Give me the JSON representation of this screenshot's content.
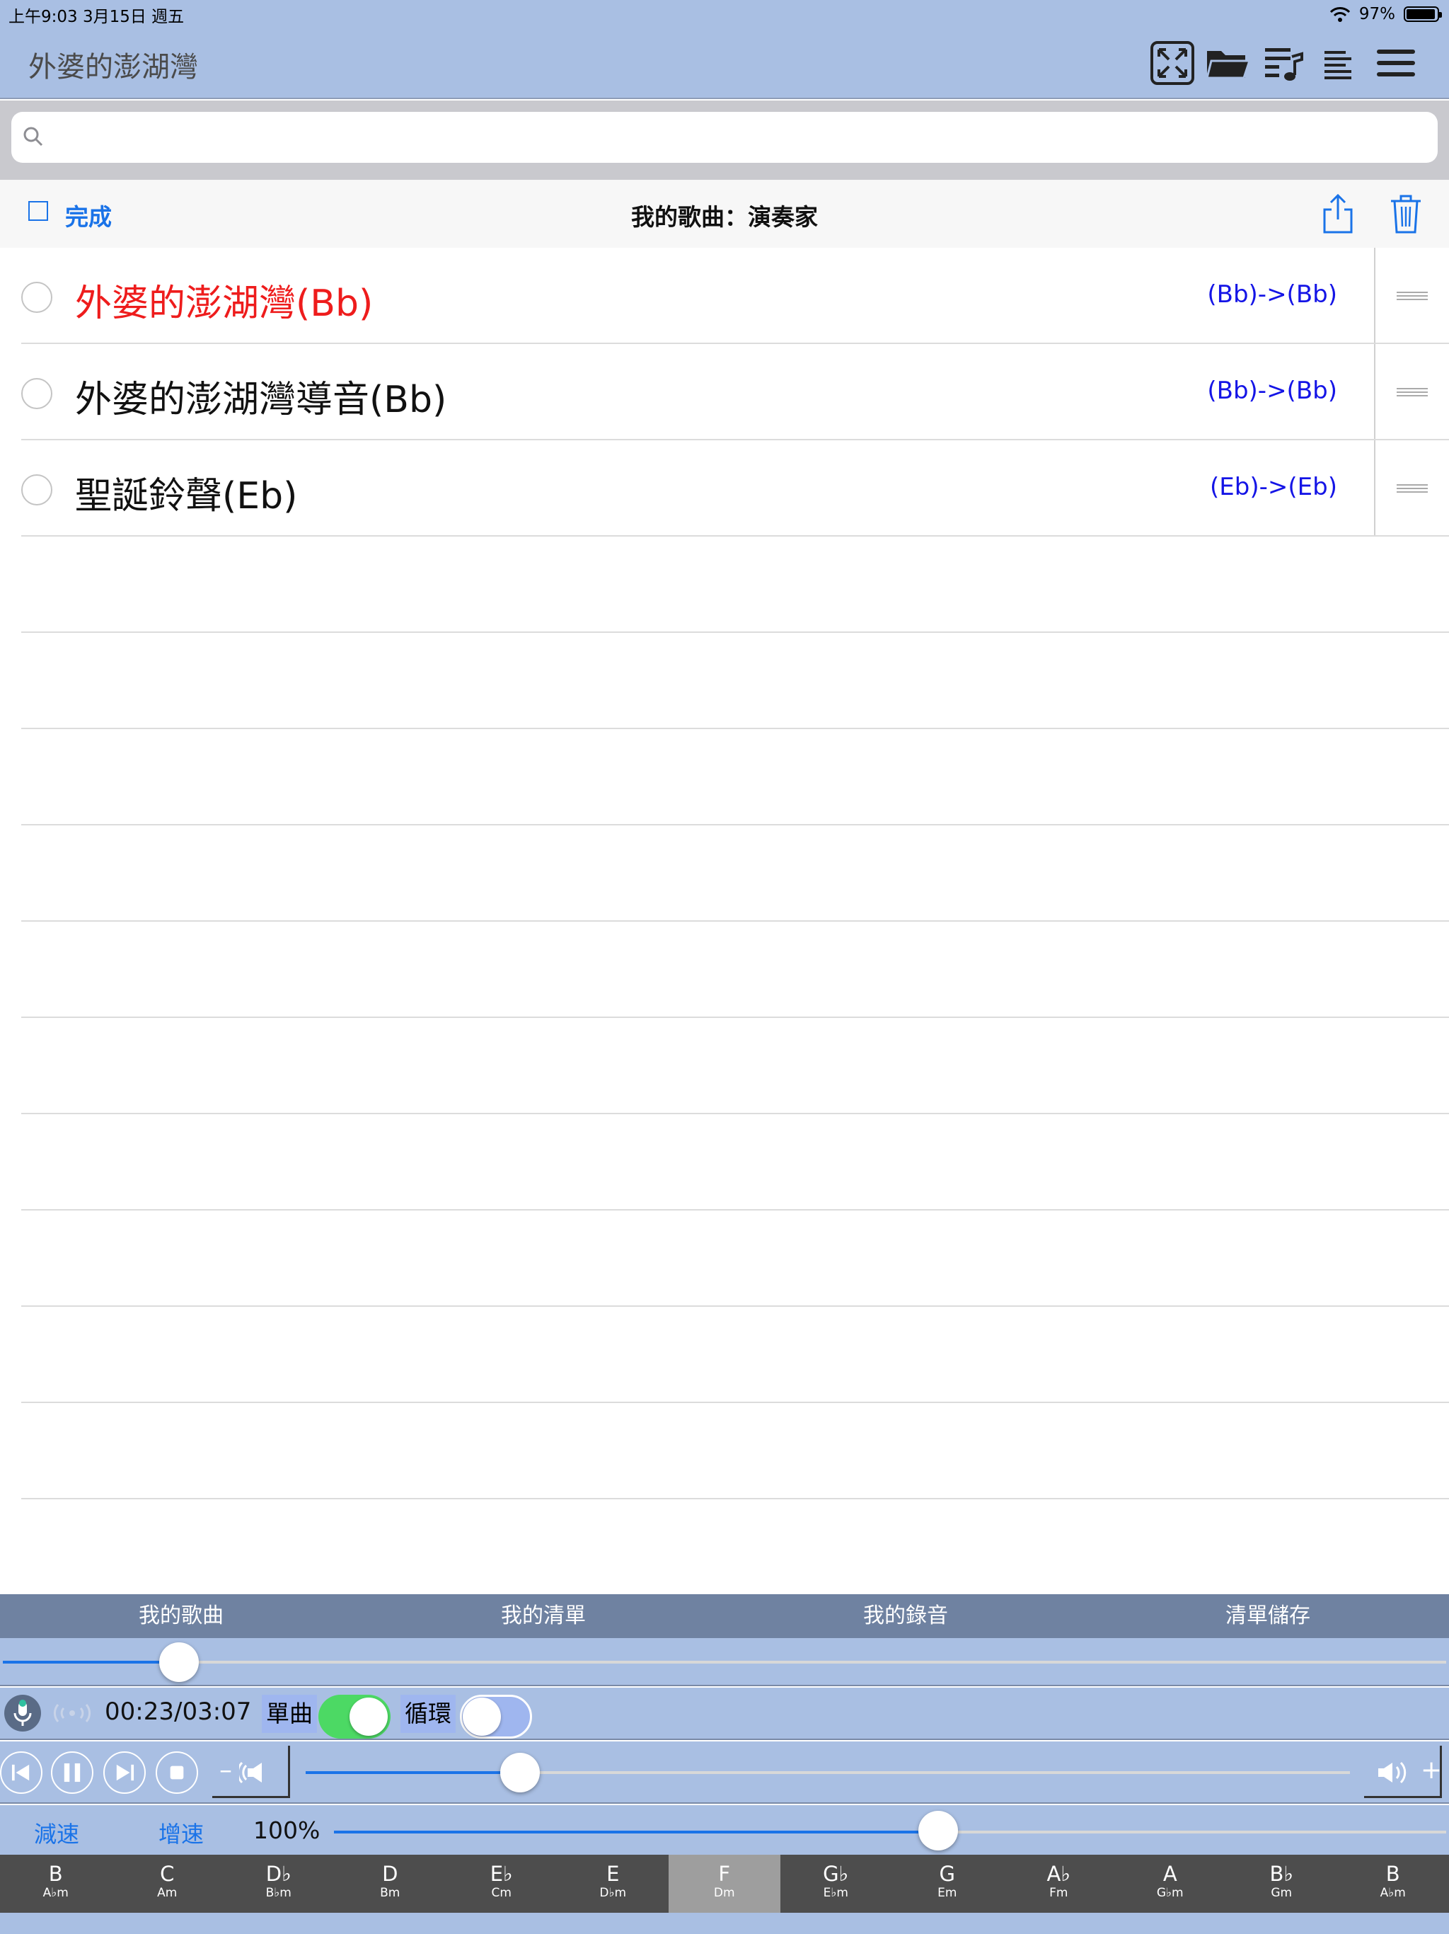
{
  "status_bar": {
    "time_date": "上午9:03   3月15日 週五",
    "battery": "97%"
  },
  "nav": {
    "title": "外婆的澎湖灣",
    "icons": [
      "fullscreen-icon",
      "folder-icon",
      "playlist-icon",
      "text-align-icon",
      "menu-icon"
    ]
  },
  "search": {
    "placeholder": "",
    "value": ""
  },
  "list_header": {
    "done_label": "完成",
    "title": "我的歌曲：演奏家"
  },
  "songs": [
    {
      "title": "外婆的澎湖灣(Bb)",
      "key": "(Bb)->(Bb)",
      "color": "#ee1c1c"
    },
    {
      "title": "外婆的澎湖灣導音(Bb)",
      "key": "(Bb)->(Bb)",
      "color": "#111111"
    },
    {
      "title": "聖誕鈴聲(Eb)",
      "key": "(Eb)->(Eb)",
      "color": "#111111"
    }
  ],
  "tabs": [
    "我的歌曲",
    "我的清單",
    "我的錄音",
    "清單儲存"
  ],
  "player": {
    "progress_fraction": 0.122,
    "time": "00:23/03:07",
    "single_label": "單曲",
    "single_on": true,
    "loop_label": "循環",
    "loop_on": false,
    "volume_fraction": 0.205,
    "volume_minus": "–",
    "volume_plus": "+",
    "slower_label": "減速",
    "faster_label": "增速",
    "speed_value": "100%",
    "speed_fraction": 0.543
  },
  "keys": [
    {
      "major": "B",
      "minor": "A♭m"
    },
    {
      "major": "C",
      "minor": "Am"
    },
    {
      "major": "D♭",
      "minor": "B♭m"
    },
    {
      "major": "D",
      "minor": "Bm"
    },
    {
      "major": "E♭",
      "minor": "Cm"
    },
    {
      "major": "E",
      "minor": "D♭m"
    },
    {
      "major": "F",
      "minor": "Dm",
      "active": true
    },
    {
      "major": "G♭",
      "minor": "E♭m"
    },
    {
      "major": "G",
      "minor": "Em"
    },
    {
      "major": "A♭",
      "minor": "Fm"
    },
    {
      "major": "A",
      "minor": "G♭m"
    },
    {
      "major": "B♭",
      "minor": "Gm"
    },
    {
      "major": "B",
      "minor": "A♭m"
    }
  ],
  "colors": {
    "bar_blue": "#a9bfe3",
    "tab_bar": "#6f82a1",
    "accent": "#1a73e8",
    "toggle_on": "#4cd964",
    "key_text": "#1414e6"
  }
}
